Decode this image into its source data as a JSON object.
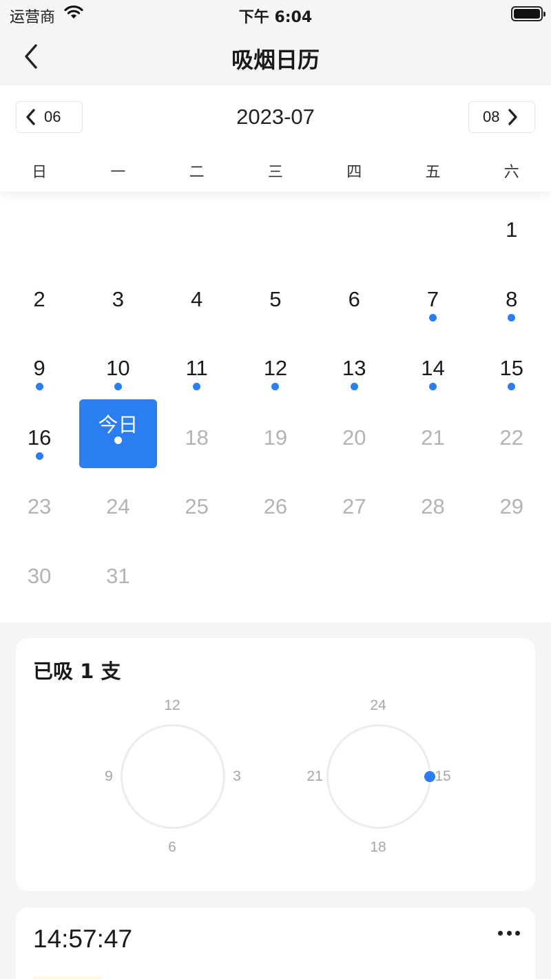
{
  "status_bar": {
    "carrier": "运营商",
    "time": "下午 6:04"
  },
  "nav": {
    "title": "吸烟日历"
  },
  "calendar": {
    "prev_month": "06",
    "next_month": "08",
    "current_month": "2023-07",
    "weekdays": [
      "日",
      "一",
      "二",
      "三",
      "四",
      "五",
      "六"
    ],
    "accent_color": "#2a7ef0",
    "weeks": [
      [
        {
          "label": ""
        },
        {
          "label": ""
        },
        {
          "label": ""
        },
        {
          "label": ""
        },
        {
          "label": ""
        },
        {
          "label": ""
        },
        {
          "label": "1",
          "dot": false,
          "future": false
        }
      ],
      [
        {
          "label": "2"
        },
        {
          "label": "3"
        },
        {
          "label": "4"
        },
        {
          "label": "5"
        },
        {
          "label": "6"
        },
        {
          "label": "7",
          "dot": true
        },
        {
          "label": "8",
          "dot": true
        }
      ],
      [
        {
          "label": "9",
          "dot": true
        },
        {
          "label": "10",
          "dot": true
        },
        {
          "label": "11",
          "dot": true
        },
        {
          "label": "12",
          "dot": true
        },
        {
          "label": "13",
          "dot": true
        },
        {
          "label": "14",
          "dot": true
        },
        {
          "label": "15",
          "dot": true
        }
      ],
      [
        {
          "label": "16",
          "dot": true
        },
        {
          "label": "今日",
          "dot": true,
          "today": true
        },
        {
          "label": "18",
          "future": true
        },
        {
          "label": "19",
          "future": true
        },
        {
          "label": "20",
          "future": true
        },
        {
          "label": "21",
          "future": true
        },
        {
          "label": "22",
          "future": true
        }
      ],
      [
        {
          "label": "23",
          "future": true
        },
        {
          "label": "24",
          "future": true
        },
        {
          "label": "25",
          "future": true
        },
        {
          "label": "26",
          "future": true
        },
        {
          "label": "27",
          "future": true
        },
        {
          "label": "28",
          "future": true
        },
        {
          "label": "29",
          "future": true
        }
      ],
      [
        {
          "label": "30",
          "future": true
        },
        {
          "label": "31",
          "future": true
        },
        {
          "label": ""
        },
        {
          "label": ""
        },
        {
          "label": ""
        },
        {
          "label": ""
        },
        {
          "label": ""
        }
      ]
    ]
  },
  "summary": {
    "title": "已吸 1 支",
    "am_clock": {
      "top": "12",
      "right": "3",
      "bottom": "6",
      "left": "9"
    },
    "pm_clock": {
      "top": "24",
      "right": "15",
      "bottom": "18",
      "left": "21"
    }
  },
  "record": {
    "time": "14:57:47"
  }
}
